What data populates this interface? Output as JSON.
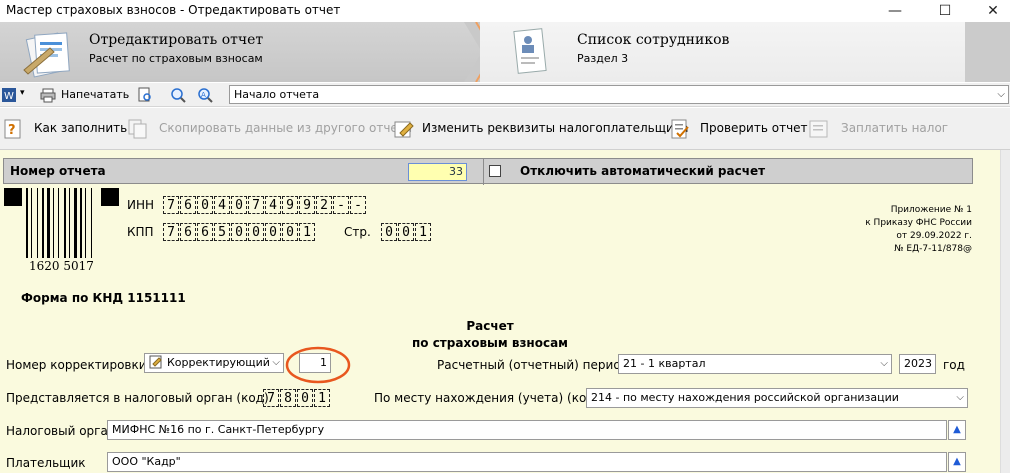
{
  "window": {
    "title": "Мастер страховых взносов - Отредактировать отчет",
    "min": "—",
    "max": "☐",
    "close": "✕"
  },
  "wizard": {
    "step1": {
      "title": "Отредактировать отчет",
      "subtitle": "Расчет по страховым взносам"
    },
    "step2": {
      "title": "Список сотрудников",
      "subtitle": "Раздел 3"
    }
  },
  "toolbar1": {
    "print_label": "Напечатать",
    "nav_value": "Начало отчета"
  },
  "toolbar2": {
    "how_to_fill": "Как заполнить",
    "copy_data": "Скопировать данные из другого отчета",
    "change_requisites": "Изменить реквизиты налогоплательщика",
    "check_report": "Проверить отчет",
    "pay_tax": "Заплатить налог"
  },
  "form": {
    "report_number_label": "Номер отчета",
    "report_number_value": "33",
    "auto_calc_label": "Отключить автоматический расчет",
    "barcode_number": "1620 5017",
    "inn_label": "ИНН",
    "inn_cells": [
      "7",
      "6",
      "0",
      "4",
      "0",
      "7",
      "4",
      "9",
      "9",
      "2",
      "-",
      "-"
    ],
    "kpp_label": "КПП",
    "kpp_cells": [
      "7",
      "6",
      "6",
      "5",
      "0",
      "0",
      "0",
      "0",
      "1"
    ],
    "page_label": "Стр.",
    "page_cells": [
      "0",
      "0",
      "1"
    ],
    "appendix": [
      "Приложение № 1",
      "к Приказу ФНС России",
      "от 29.09.2022 г.",
      "№ ЕД-7-11/878@"
    ],
    "knd_form": "Форма по КНД 1151111",
    "heading1": "Расчет",
    "heading2": "по страховым взносам",
    "correction_label": "Номер корректировки",
    "correction_type": "Корректирующий",
    "correction_number": "1",
    "period_label": "Расчетный (отчетный) период",
    "period_value": "21 - 1 квартал",
    "year_value": "2023",
    "year_label": "год",
    "tax_authority_code_label": "Представляется в налоговый орган (код)",
    "tax_authority_cells": [
      "7",
      "8",
      "0",
      "1"
    ],
    "location_label": "По месту нахождения (учета) (код)",
    "location_value": "214 - по месту нахождения российской организации",
    "tax_authority_label": "Налоговый орган",
    "tax_authority_value": "МИФНС №16 по г. Санкт-Петербургу",
    "payer_label": "Плательщик",
    "payer_value": "ООО \"Кадр\""
  },
  "colors": {
    "form_bg": "#fafade",
    "annotation_circle": "#e8571f",
    "highlight_field": "#ffffb0"
  }
}
